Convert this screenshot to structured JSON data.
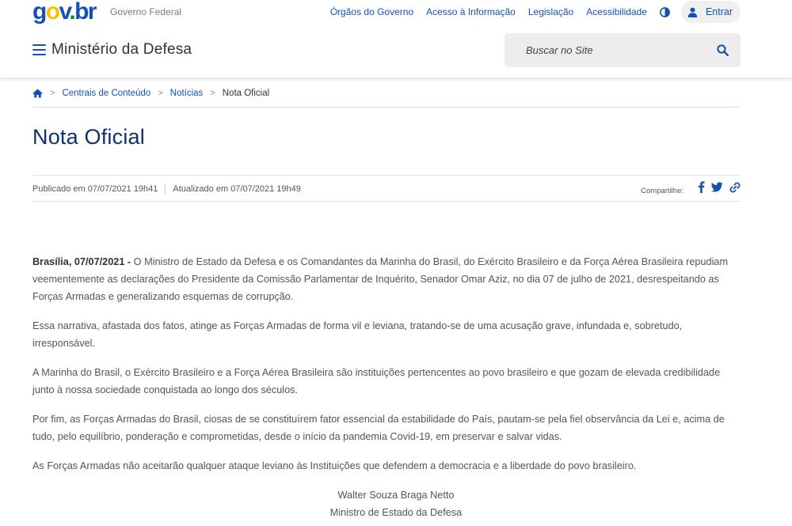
{
  "header": {
    "logo": {
      "g": "g",
      "o": "o",
      "v": "v",
      "dot": ".",
      "br": "br"
    },
    "gov_text": "Governo Federal",
    "top_links": [
      "Órgãos do Governo",
      "Acesso à Informação",
      "Legislação",
      "Acessibilidade"
    ],
    "login_label": "Entrar",
    "site_name": "Ministério da Defesa",
    "search_placeholder": "Buscar no Site"
  },
  "breadcrumb": {
    "items": [
      "Centrais de Conteúdo",
      "Notícias"
    ],
    "current": "Nota Oficial",
    "separator": ">"
  },
  "article": {
    "title": "Nota Oficial",
    "published": "Publicado em 07/07/2021 19h41",
    "updated": "Atualizado em 07/07/2021 19h49",
    "share_label": "Compartilhe:",
    "lead_bold": "Brasília, 07/07/2021 -",
    "lead_text": " O Ministro de Estado da Defesa e os Comandantes da Marinha do Brasil, do Exército Brasileiro e da Força Aérea Brasileira repudiam veementemente as declarações do Presidente da Comissão Parlamentar de Inquérito, Senador Omar Aziz, no dia 07 de julho de 2021, desrespeitando as Forças Armadas e generalizando esquemas de corrupção.",
    "paragraphs": [
      "Essa narrativa, afastada dos fatos, atinge as Forças Armadas de forma vil e leviana, tratando-se de uma acusação grave, infundada e, sobretudo, irresponsável.",
      "A Marinha do Brasil, o Exército Brasileiro e a Força Aérea Brasileira são instituições pertencentes ao povo brasileiro e que gozam de elevada credibilidade junto à nossa sociedade conquistada ao longo dos séculos.",
      "Por fim, as Forças Armadas do Brasil, ciosas de se constituírem fator essencial da estabilidade do País, pautam-se pela fiel observância da Lei e, acima de tudo, pelo equilíbrio, ponderação e comprometidas, desde o início da pandemia Covid-19, em preservar e salvar vidas.",
      "As Forças Armadas não aceitarão qualquer ataque leviano às Instituições que defendem a democracia e a liberdade do povo brasileiro."
    ],
    "signature_name": "Walter Souza Braga Netto",
    "signature_role": "Ministro de Estado da Defesa"
  },
  "icons": {
    "contrast": "contrast-icon",
    "user": "user-icon",
    "menu": "hamburger-menu-icon",
    "search": "search-icon",
    "home": "home-icon",
    "facebook": "facebook-icon",
    "twitter": "twitter-icon",
    "link": "link-icon"
  },
  "colors": {
    "primary": "#1351b4",
    "title": "#0c326f",
    "logo_yellow": "#f6c300",
    "logo_green": "#168821"
  }
}
